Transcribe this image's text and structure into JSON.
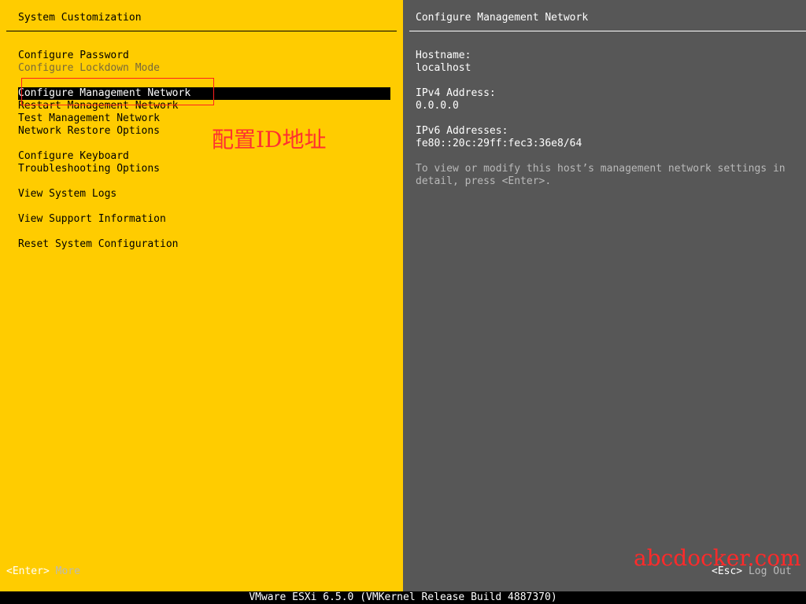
{
  "left_panel": {
    "title": "System Customization",
    "menu": [
      {
        "label": "Configure Password",
        "state": "normal"
      },
      {
        "label": "Configure Lockdown Mode",
        "state": "disabled"
      },
      {
        "label": "Configure Management Network",
        "state": "selected"
      },
      {
        "label": "Restart Management Network",
        "state": "normal"
      },
      {
        "label": "Test Management Network",
        "state": "normal"
      },
      {
        "label": "Network Restore Options",
        "state": "normal"
      },
      {
        "label": "Configure Keyboard",
        "state": "normal"
      },
      {
        "label": "Troubleshooting Options",
        "state": "normal"
      },
      {
        "label": "View System Logs",
        "state": "normal"
      },
      {
        "label": "View Support Information",
        "state": "normal"
      },
      {
        "label": "Reset System Configuration",
        "state": "normal"
      }
    ]
  },
  "right_panel": {
    "title": "Configure Management Network",
    "hostname_label": "Hostname:",
    "hostname_value": "localhost",
    "ipv4_label": "IPv4 Address:",
    "ipv4_value": "0.0.0.0",
    "ipv6_label": "IPv6 Addresses:",
    "ipv6_value": "fe80::20c:29ff:fec3:36e8/64",
    "help_text": "To view or modify this host’s management network settings in detail, press <Enter>."
  },
  "footer": {
    "enter_key": "<Enter>",
    "enter_action": "More",
    "esc_key": "<Esc>",
    "esc_action": "Log Out"
  },
  "status_bar": {
    "text": "VMware ESXi 6.5.0 (VMKernel Release Build 4887370)"
  },
  "overlay": {
    "annotation_text": "配置ID地址",
    "watermark_text": "abcdocker.com"
  },
  "colors": {
    "left_bg": "#ffcc00",
    "right_bg": "#575757",
    "annotation": "#ff2020"
  }
}
